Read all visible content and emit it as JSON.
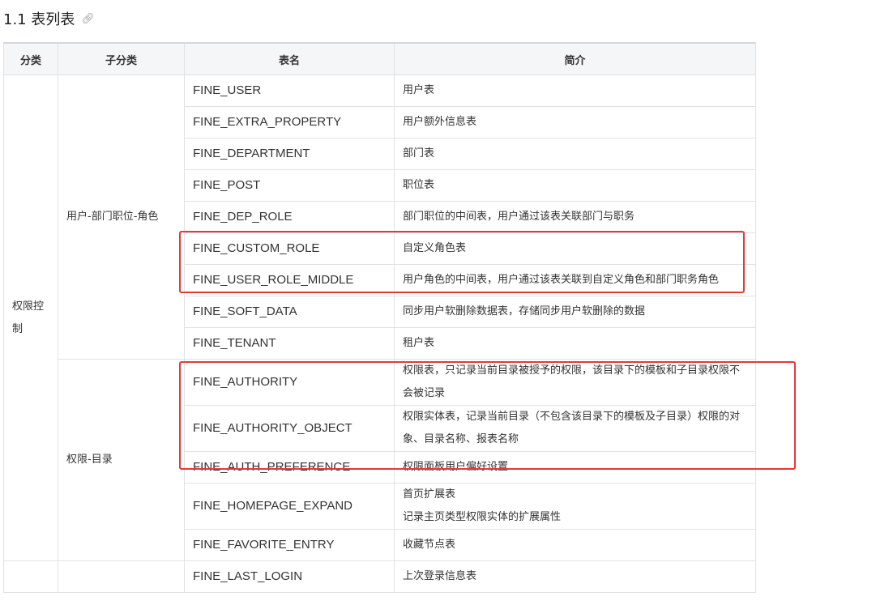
{
  "heading": {
    "title": "1.1 表列表",
    "link_icon": "link-icon"
  },
  "table": {
    "headers": [
      "分类",
      "子分类",
      "表名",
      "简介"
    ],
    "category": "权限控制",
    "subcategories": [
      "用户-部门职位-角色",
      "权限-目录"
    ],
    "rows": [
      {
        "name": "FINE_USER",
        "desc": "用户表"
      },
      {
        "name": "FINE_EXTRA_PROPERTY",
        "desc": "用户额外信息表"
      },
      {
        "name": "FINE_DEPARTMENT",
        "desc": "部门表"
      },
      {
        "name": "FINE_POST",
        "desc": "职位表"
      },
      {
        "name": "FINE_DEP_ROLE",
        "desc": "部门职位的中间表，用户通过该表关联部门与职务"
      },
      {
        "name": "FINE_CUSTOM_ROLE",
        "desc": "自定义角色表"
      },
      {
        "name": "FINE_USER_ROLE_MIDDLE",
        "desc": "用户角色的中间表，用户通过该表关联到自定义角色和部门职务角色"
      },
      {
        "name": "FINE_SOFT_DATA",
        "desc": "同步用户软删除数据表，存储同步用户软删除的数据"
      },
      {
        "name": "FINE_TENANT",
        "desc": "租户表"
      },
      {
        "name": "FINE_AUTHORITY",
        "desc": "权限表，只记录当前目录被授予的权限，该目录下的模板和子目录权限不会被记录"
      },
      {
        "name": "FINE_AUTHORITY_OBJECT",
        "desc": "权限实体表，记录当前目录（不包含该目录下的模板及子目录）权限的对象、目录名称、报表名称"
      },
      {
        "name": "FINE_AUTH_PREFERENCE",
        "desc": "权限面板用户偏好设置"
      },
      {
        "name": "FINE_HOMEPAGE_EXPAND",
        "desc": "首页扩展表",
        "desc2": "记录主页类型权限实体的扩展属性"
      },
      {
        "name": "FINE_FAVORITE_ENTRY",
        "desc": "收藏节点表"
      },
      {
        "name": "FINE_LAST_LOGIN",
        "desc": "上次登录信息表"
      }
    ]
  },
  "annotation_color": "#e53935"
}
